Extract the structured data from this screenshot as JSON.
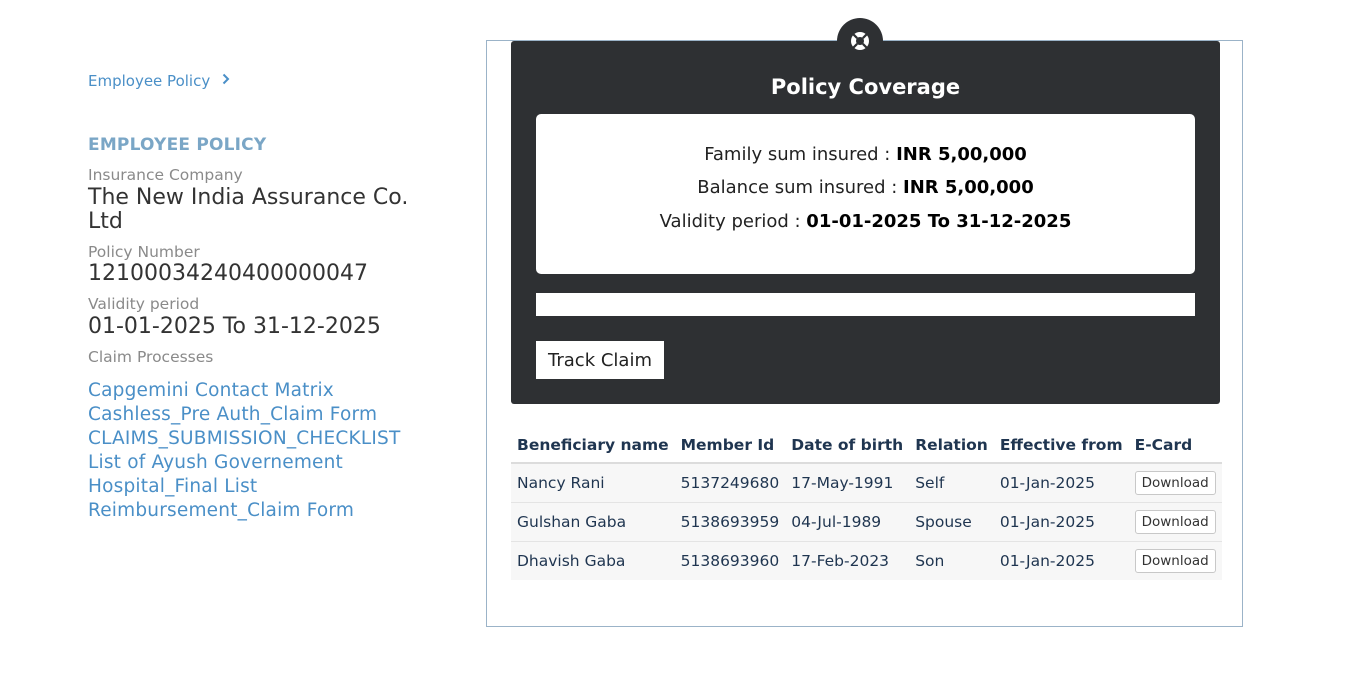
{
  "breadcrumb": {
    "label": "Employee Policy",
    "chevron_icon": "chevron-right-icon"
  },
  "policy": {
    "section_title": "EMPLOYEE POLICY",
    "insurance_company_label": "Insurance Company",
    "insurance_company": "The New India Assurance Co. Ltd",
    "policy_number_label": "Policy Number",
    "policy_number": "12100034240400000047",
    "validity_label": "Validity period",
    "validity": "01-01-2025 To 31-12-2025",
    "claim_processes_label": "Claim Processes",
    "documents": [
      "Capgemini Contact Matrix",
      "Cashless_Pre Auth_Claim Form",
      "CLAIMS_SUBMISSION_CHECKLIST",
      "List of Ayush Governement",
      "Hospital_Final List",
      "Reimbursement_Claim Form"
    ]
  },
  "coverage": {
    "icon": "lifebuoy-icon",
    "title": "Policy Coverage",
    "family_label": "Family sum insured : ",
    "family_value": "INR 5,00,000",
    "balance_label": "Balance sum insured : ",
    "balance_value": "INR 5,00,000",
    "validity_label": "Validity period : ",
    "validity_value": "01-01-2025 To 31-12-2025",
    "track_claim_label": "Track Claim"
  },
  "table": {
    "headers": [
      "Beneficiary name",
      "Member Id",
      "Date of birth",
      "Relation",
      "Effective from",
      "E-Card"
    ],
    "rows": [
      {
        "name": "Nancy Rani",
        "member_id": "5137249680",
        "dob": "17-May-1991",
        "relation": "Self",
        "effective": "01-Jan-2025",
        "ecard": "Download"
      },
      {
        "name": "Gulshan Gaba",
        "member_id": "5138693959",
        "dob": "04-Jul-1989",
        "relation": "Spouse",
        "effective": "01-Jan-2025",
        "ecard": "Download"
      },
      {
        "name": "Dhavish Gaba",
        "member_id": "5138693960",
        "dob": "17-Feb-2023",
        "relation": "Son",
        "effective": "01-Jan-2025",
        "ecard": "Download"
      }
    ]
  },
  "colors": {
    "accent": "#4a8fc7",
    "section_title": "#7aa6c6",
    "dark_card": "#2e3033",
    "table_text": "#1f3550"
  }
}
